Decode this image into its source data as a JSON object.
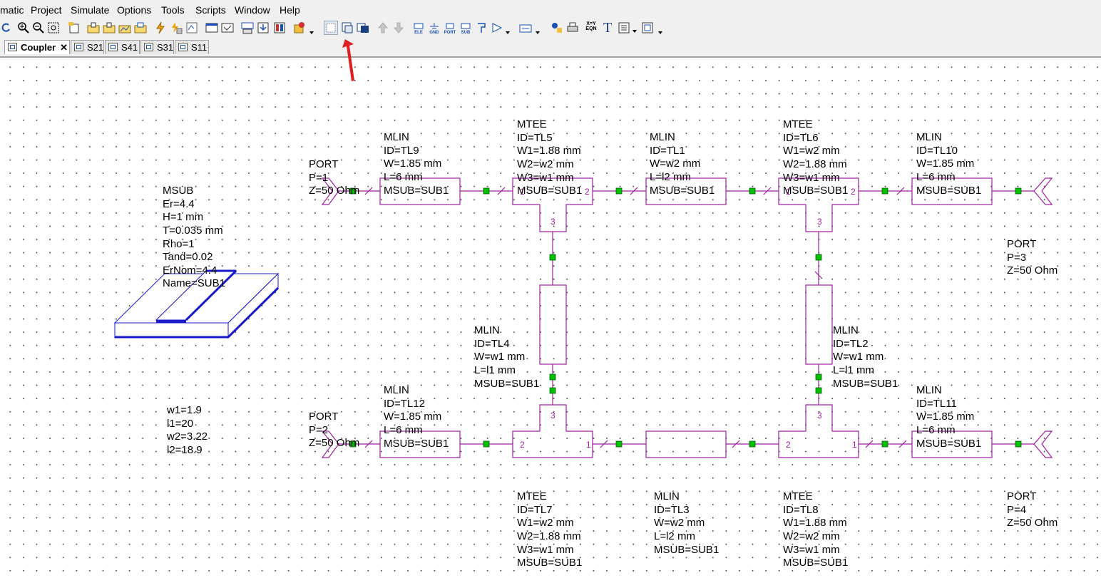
{
  "menu": [
    "matic",
    "Project",
    "Simulate",
    "Options",
    "Tools",
    "Scripts",
    "Window",
    "Help"
  ],
  "toolbar_text": {
    "ele": "ELE",
    "gnd": "GND",
    "port": "PORT",
    "sub": "SUB",
    "eqn": "X=Y\nEQN",
    "text_tool": "T"
  },
  "tabs": [
    {
      "label": "Coupler",
      "active": true,
      "close": "✕"
    },
    {
      "label": "S21"
    },
    {
      "label": "S41"
    },
    {
      "label": "S31"
    },
    {
      "label": "S11"
    }
  ],
  "colors": {
    "wire": "#a020a0",
    "node": "#00c000",
    "substrate": "#1a1ac8",
    "arrow": "#e02020"
  },
  "msub": {
    "lines": [
      "MSUB",
      "Er=4.4",
      "H=1 mm",
      "T=0.035 mm",
      "Rho=1",
      "Tand=0.02",
      "ErNom=4.4",
      "Name=SUB1"
    ]
  },
  "variables": {
    "lines": [
      "w1=1.9",
      "l1=20",
      "w2=3.22",
      "l2=18.9"
    ]
  },
  "components": {
    "port1": [
      "PORT",
      "P=1",
      "Z=50 Ohm"
    ],
    "port2": [
      "PORT",
      "P=2",
      "Z=50 Ohm"
    ],
    "port3": [
      "PORT",
      "P=3",
      "Z=50 Ohm"
    ],
    "port4": [
      "PORT",
      "P=4",
      "Z=50 Ohm"
    ],
    "tl9": [
      "MLIN",
      "ID=TL9",
      "W=1.85 mm",
      "L=6 mm",
      "MSUB=SUB1"
    ],
    "tl5": [
      "MTEE",
      "ID=TL5",
      "W1=1.88 mm",
      "W2=w2 mm",
      "W3=w1 mm",
      "MSUB=SUB1"
    ],
    "tl1": [
      "MLIN",
      "ID=TL1",
      "W=w2 mm",
      "L=l2 mm",
      "MSUB=SUB1"
    ],
    "tl6": [
      "MTEE",
      "ID=TL6",
      "W1=w2 mm",
      "W2=1.88 mm",
      "W3=w1 mm",
      "MSUB=SUB1"
    ],
    "tl10": [
      "MLIN",
      "ID=TL10",
      "W=1.85 mm",
      "L=6 mm",
      "MSUB=SUB1"
    ],
    "tl4": [
      "MLIN",
      "ID=TL4",
      "W=w1 mm",
      "L=l1 mm",
      "MSUB=SUB1"
    ],
    "tl2": [
      "MLIN",
      "ID=TL2",
      "W=w1 mm",
      "L=l1 mm",
      "MSUB=SUB1"
    ],
    "tl12": [
      "MLIN",
      "ID=TL12",
      "W=1.85 mm",
      "L=6 mm",
      "MSUB=SUB1"
    ],
    "tl11": [
      "MLIN",
      "ID=TL11",
      "W=1.85 mm",
      "L=6 mm",
      "MSUB=SUB1"
    ],
    "tl7": [
      "MTEE",
      "ID=TL7",
      "W1=w2 mm",
      "W2=1.88 mm",
      "W3=w1 mm",
      "MSUB=SUB1"
    ],
    "tl3": [
      "MLIN",
      "ID=TL3",
      "W=w2 mm",
      "L=l2 mm",
      "MSUB=SUB1"
    ],
    "tl8": [
      "MTEE",
      "ID=TL8",
      "W1=1.88 mm",
      "W2=w2 mm",
      "W3=w1 mm",
      "MSUB=SUB1"
    ]
  },
  "pins": {
    "one": "1",
    "two": "2",
    "three": "3"
  }
}
